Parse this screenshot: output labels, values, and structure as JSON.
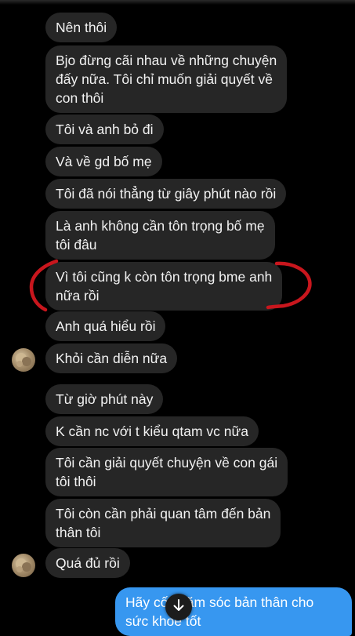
{
  "messages": [
    {
      "text": "Nên thôi"
    },
    {
      "text": "Bjo đừng cãi nhau về những chuyện\nđấy nữa. Tôi chỉ muốn giải quyết về\ncon thôi"
    },
    {
      "text": "Tôi và anh bỏ đi"
    },
    {
      "text": "Và về gd bố mẹ"
    },
    {
      "text": "Tôi đã nói thẳng từ giây phút nào rồi"
    },
    {
      "text": "Là anh không cần tôn trọng bố mẹ\ntôi đâu"
    },
    {
      "text": "Vì tôi cũng k còn tôn trọng bme anh\nnữa rồi"
    },
    {
      "text": "Anh quá hiểu rồi"
    },
    {
      "text": "Khỏi cần diễn nữa"
    },
    {
      "text": "Từ giờ phút này"
    },
    {
      "text": "K cần nc với t kiểu qtam vc nữa"
    },
    {
      "text": "Tôi cần giải quyết chuyện về con gái\ntôi thôi"
    },
    {
      "text": "Tôi còn cần phải quan tâm đến bản\nthân tôi"
    },
    {
      "text": "Quá đủ rồi"
    },
    {
      "text": "Hãy cố chăm sóc bản thân cho\nsức khoẻ tốt"
    }
  ],
  "icons": {
    "scroll_down": "arrow-down-icon",
    "avatar": "contact-avatar"
  },
  "colors": {
    "incoming_bubble": "#262626",
    "outgoing_bubble": "#3797f0",
    "annotation": "#c8161d"
  }
}
